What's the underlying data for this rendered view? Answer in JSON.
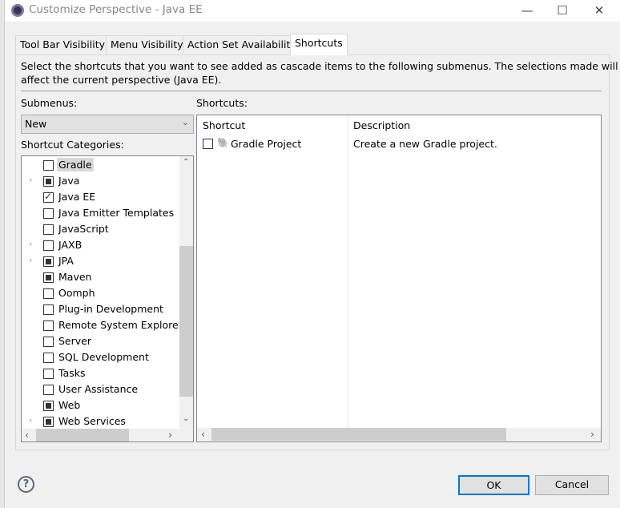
{
  "window": {
    "title": "Customize Perspective - Java EE"
  },
  "tabs": [
    {
      "label": "Tool Bar Visibility"
    },
    {
      "label": "Menu Visibility"
    },
    {
      "label": "Action Set Availability"
    },
    {
      "label": "Shortcuts",
      "active": true
    }
  ],
  "description_line1": "Select the shortcuts that you want to see added as cascade items to the following submenus.  The selections made will only",
  "description_line2": "affect the current perspective (Java EE).",
  "submenus": {
    "label": "Submenus:",
    "selected": "New"
  },
  "categories": {
    "label": "Shortcut Categories:",
    "items": [
      {
        "label": "Gradle",
        "state": "unchecked",
        "expandable": false,
        "selected": true
      },
      {
        "label": "Java",
        "state": "partial",
        "expandable": true
      },
      {
        "label": "Java EE",
        "state": "checked",
        "expandable": false
      },
      {
        "label": "Java Emitter Templates",
        "state": "unchecked",
        "expandable": false
      },
      {
        "label": "JavaScript",
        "state": "unchecked",
        "expandable": false
      },
      {
        "label": "JAXB",
        "state": "unchecked",
        "expandable": true
      },
      {
        "label": "JPA",
        "state": "partial",
        "expandable": true
      },
      {
        "label": "Maven",
        "state": "partial",
        "expandable": false
      },
      {
        "label": "Oomph",
        "state": "unchecked",
        "expandable": false
      },
      {
        "label": "Plug-in Development",
        "state": "unchecked",
        "expandable": false
      },
      {
        "label": "Remote System Explorer",
        "state": "unchecked",
        "expandable": false
      },
      {
        "label": "Server",
        "state": "unchecked",
        "expandable": false
      },
      {
        "label": "SQL Development",
        "state": "unchecked",
        "expandable": false
      },
      {
        "label": "Tasks",
        "state": "unchecked",
        "expandable": false
      },
      {
        "label": "User Assistance",
        "state": "unchecked",
        "expandable": false
      },
      {
        "label": "Web",
        "state": "partial",
        "expandable": false
      },
      {
        "label": "Web Services",
        "state": "partial",
        "expandable": true
      }
    ]
  },
  "shortcuts": {
    "label": "Shortcuts:",
    "columns": [
      "Shortcut",
      "Description"
    ],
    "rows": [
      {
        "name": "Gradle Project",
        "description": "Create a new Gradle project.",
        "checked": false
      }
    ]
  },
  "buttons": {
    "ok": "OK",
    "cancel": "Cancel",
    "help": "?"
  }
}
